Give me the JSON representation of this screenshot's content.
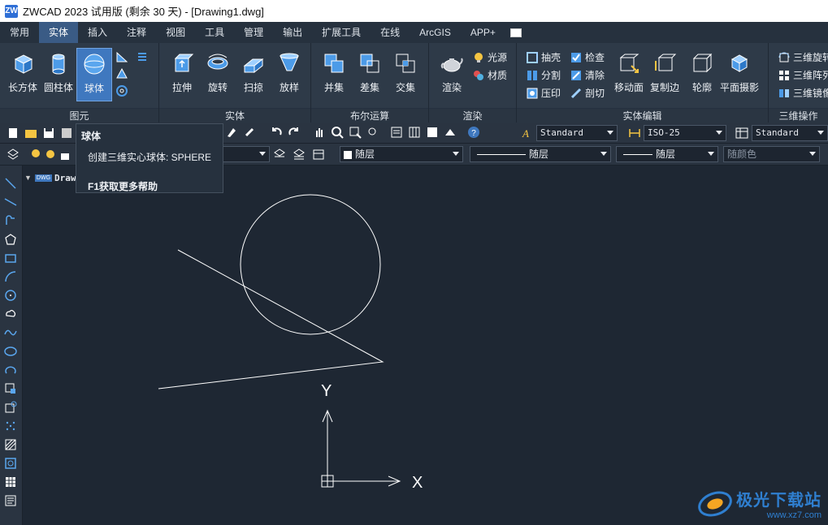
{
  "window": {
    "title": "ZWCAD 2023 试用版 (剩余 30 天) - [Drawing1.dwg]",
    "logo": "ZW"
  },
  "menu": {
    "tabs": [
      "常用",
      "实体",
      "插入",
      "注释",
      "视图",
      "工具",
      "管理",
      "输出",
      "扩展工具",
      "在线",
      "ArcGIS",
      "APP+"
    ],
    "active": "实体"
  },
  "ribbon": {
    "primitives": {
      "label": "图元",
      "box": "长方体",
      "cylinder": "圆柱体",
      "sphere": "球体"
    },
    "solid": {
      "label": "实体",
      "extrude": "拉伸",
      "revolve": "旋转",
      "sweep": "扫掠",
      "loft": "放样"
    },
    "boolean": {
      "label": "布尔运算",
      "union": "并集",
      "subtract": "差集",
      "intersect": "交集"
    },
    "render": {
      "label": "渲染",
      "render": "渲染",
      "light": "光源",
      "material": "材质"
    },
    "solidedit": {
      "label": "实体编辑",
      "shell": "抽壳",
      "check": "检查",
      "separate": "分割",
      "clean": "清除",
      "imprint": "压印",
      "slice": "剖切",
      "moveface": "移动面",
      "copyedge": "复制边",
      "profile": "轮廓",
      "flatshot": "平面摄影"
    },
    "ops3d": {
      "label": "三维操作",
      "rotate3d": "三维旋转",
      "array3d": "三维阵列",
      "mirror3d": "三维镜像"
    }
  },
  "toolbar": {
    "textstyle": "Standard",
    "dimstyle": "ISO-25",
    "tablestyle": "Standard",
    "color": "随层",
    "linetype": "随层",
    "lineweight": "随层",
    "plotstyle": "随颜色"
  },
  "tooltip": {
    "title": "球体",
    "description": "创建三维实心球体: SPHERE",
    "help": "F1获取更多帮助"
  },
  "drawing_tab": {
    "label": "Drawi",
    "badge": "DWG"
  },
  "ucs": {
    "x_label": "X",
    "y_label": "Y"
  },
  "watermark": {
    "main": "极光下载站",
    "sub": "www.xz7.com"
  },
  "colors": {
    "accent": "#3f78bf",
    "canvas": "#1e2733",
    "ribbon": "#2e3a48"
  }
}
